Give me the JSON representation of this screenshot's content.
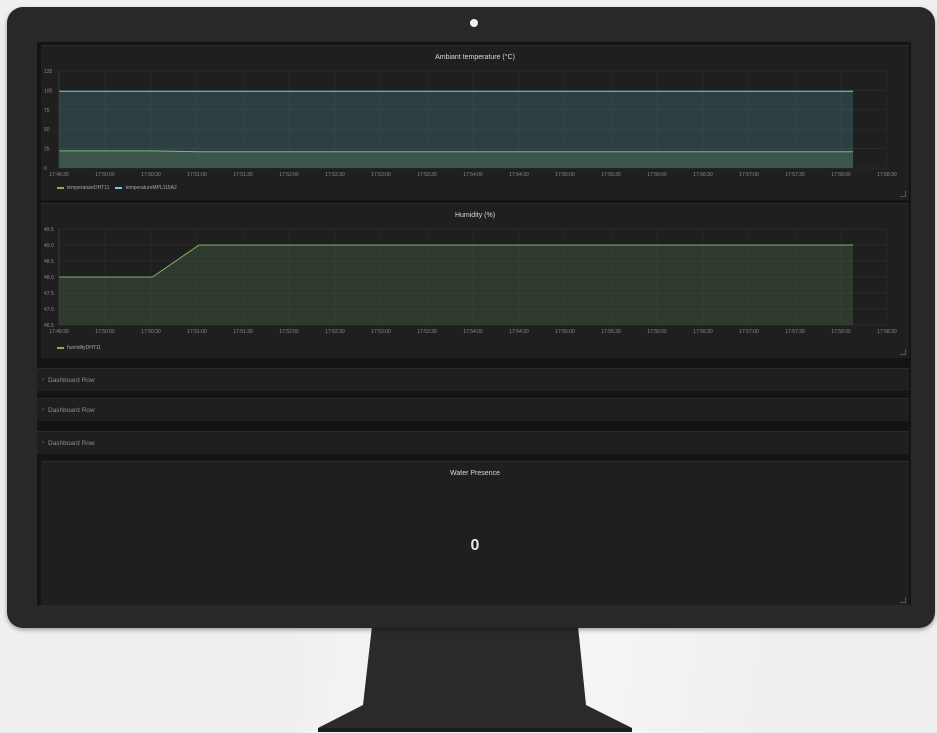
{
  "colors": {
    "accent_green": "#7eb26d",
    "accent_blue": "#6ed0e0"
  },
  "temperature_panel": {
    "title": "Ambiant temperature (°C)",
    "legend": [
      {
        "label": "temperatureDHT11",
        "color": "#7eb26d"
      },
      {
        "label": "temperatureMPL115A2",
        "color": "#6ed0e0"
      }
    ]
  },
  "humidity_panel": {
    "title": "Humidity (%)",
    "legend": [
      {
        "label": "humidityDHT11",
        "color": "#7eb26d"
      }
    ]
  },
  "rows": [
    {
      "label": "Dashboard Row"
    },
    {
      "label": "Dashboard Row"
    },
    {
      "label": "Dashboard Row"
    }
  ],
  "water_panel": {
    "title": "Water Presence",
    "value": "0"
  },
  "chart_data": [
    {
      "type": "area",
      "title": "Ambiant temperature (°C)",
      "x": [
        "17:49:30",
        "17:50:00",
        "17:50:30",
        "17:51:00",
        "17:51:30",
        "17:52:00",
        "17:52:30",
        "17:53:00",
        "17:53:30",
        "17:54:00",
        "17:54:30",
        "17:55:00",
        "17:55:30",
        "17:56:00",
        "17:56:30",
        "17:57:00",
        "17:57:30",
        "17:58:00",
        "17:58:30"
      ],
      "y_ticks": [
        "0",
        "25",
        "50",
        "75",
        "100",
        "125"
      ],
      "ylim": [
        0,
        125
      ],
      "series": [
        {
          "name": "temperatureDHT11",
          "color": "#7eb26d",
          "values": [
            22,
            22,
            22,
            21,
            21,
            21,
            21,
            21,
            21,
            21,
            21,
            21,
            21,
            21,
            21,
            21,
            21,
            21
          ]
        },
        {
          "name": "temperatureMPL115A2",
          "color": "#6ed0e0",
          "values": [
            99,
            99,
            99,
            99,
            99,
            99,
            99,
            99,
            99,
            99,
            99,
            99,
            99,
            99,
            99,
            99,
            99,
            99
          ]
        }
      ],
      "grid": true,
      "legend_position": "bottom-left"
    },
    {
      "type": "area",
      "title": "Humidity (%)",
      "x": [
        "17:49:30",
        "17:50:00",
        "17:50:30",
        "17:51:00",
        "17:51:30",
        "17:52:00",
        "17:52:30",
        "17:53:00",
        "17:53:30",
        "17:54:00",
        "17:54:30",
        "17:55:00",
        "17:55:30",
        "17:56:00",
        "17:56:30",
        "17:57:00",
        "17:57:30",
        "17:58:00",
        "17:58:30"
      ],
      "y_ticks": [
        "46.5",
        "47.0",
        "47.5",
        "48.0",
        "48.5",
        "49.0",
        "49.5"
      ],
      "ylim": [
        46.5,
        49.5
      ],
      "series": [
        {
          "name": "humidityDHT11",
          "color": "#7eb26d",
          "values": [
            48,
            48,
            48,
            49,
            49,
            49,
            49,
            49,
            49,
            49,
            49,
            49,
            49,
            49,
            49,
            49,
            49,
            49
          ]
        }
      ],
      "grid": true,
      "legend_position": "bottom-left"
    }
  ]
}
